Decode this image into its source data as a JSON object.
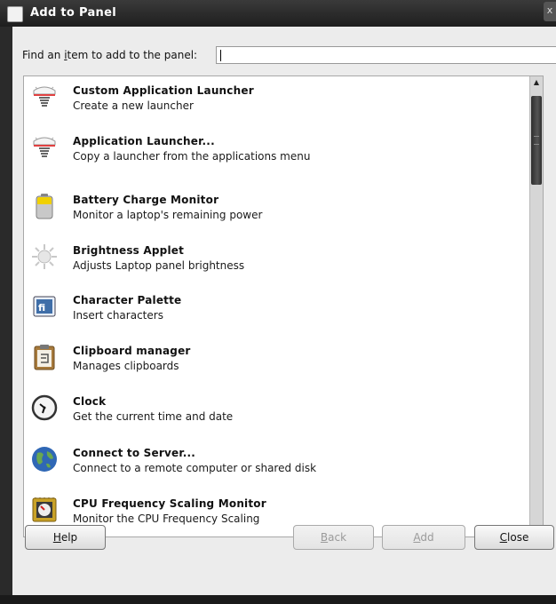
{
  "window": {
    "title": "Add to Panel",
    "close_glyph": "x"
  },
  "find": {
    "label_before": "Find an ",
    "label_mnemonic": "i",
    "label_after": "tem to add to the panel:",
    "value": ""
  },
  "items": [
    {
      "name": "Custom Application Launcher",
      "desc": "Create a new launcher",
      "icon": "launcher-spring-icon"
    },
    {
      "name": "Application Launcher...",
      "desc": "Copy a launcher from the applications menu",
      "icon": "launcher-spring-icon"
    },
    {
      "name": "Battery Charge Monitor",
      "desc": "Monitor a laptop's remaining power",
      "icon": "battery-icon"
    },
    {
      "name": "Brightness Applet",
      "desc": "Adjusts Laptop panel brightness",
      "icon": "brightness-sun-icon"
    },
    {
      "name": "Character Palette",
      "desc": "Insert characters",
      "icon": "character-palette-icon"
    },
    {
      "name": "Clipboard manager",
      "desc": "Manages clipboards",
      "icon": "clipboard-icon"
    },
    {
      "name": "Clock",
      "desc": "Get the current time and date",
      "icon": "clock-icon"
    },
    {
      "name": "Connect to Server...",
      "desc": "Connect to a remote computer or shared disk",
      "icon": "globe-icon"
    },
    {
      "name": "CPU Frequency Scaling Monitor",
      "desc": "Monitor the CPU Frequency Scaling",
      "icon": "cpu-gauge-icon"
    }
  ],
  "scrollbar": {
    "up_glyph": "▲",
    "down_glyph": "▼"
  },
  "buttons": {
    "help": {
      "mnemonic": "H",
      "rest": "elp",
      "enabled": true
    },
    "back": {
      "mnemonic": "B",
      "rest": "ack",
      "enabled": false
    },
    "add": {
      "mnemonic": "A",
      "rest": "dd",
      "enabled": false
    },
    "close": {
      "mnemonic": "C",
      "rest": "lose",
      "enabled": true
    }
  }
}
